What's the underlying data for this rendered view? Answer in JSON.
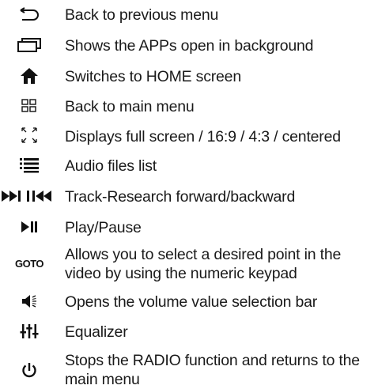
{
  "items": [
    {
      "icon": "back-arrow-icon",
      "label": "Back to previous menu"
    },
    {
      "icon": "recent-apps-icon",
      "label": "Shows the APPs open in background"
    },
    {
      "icon": "home-icon",
      "label": "Switches to HOME screen"
    },
    {
      "icon": "grid-menu-icon",
      "label": "Back to main menu"
    },
    {
      "icon": "fullscreen-icon",
      "label": "Displays full screen / 16:9 / 4:3 / centered"
    },
    {
      "icon": "list-icon",
      "label": "Audio files list"
    },
    {
      "icon": "skip-forward-backward-icon",
      "label": "Track-Research forward/backward"
    },
    {
      "icon": "play-pause-icon",
      "label": "Play/Pause"
    },
    {
      "icon": "goto-icon",
      "icon_text": "GOTO",
      "label": "Allows you to select a desired point in the video by using the numeric keypad"
    },
    {
      "icon": "volume-icon",
      "label": "Opens the volume value selection bar"
    },
    {
      "icon": "equalizer-icon",
      "label": "Equalizer"
    },
    {
      "icon": "power-icon",
      "label": "Stops the RADIO function and returns to the main menu"
    }
  ]
}
